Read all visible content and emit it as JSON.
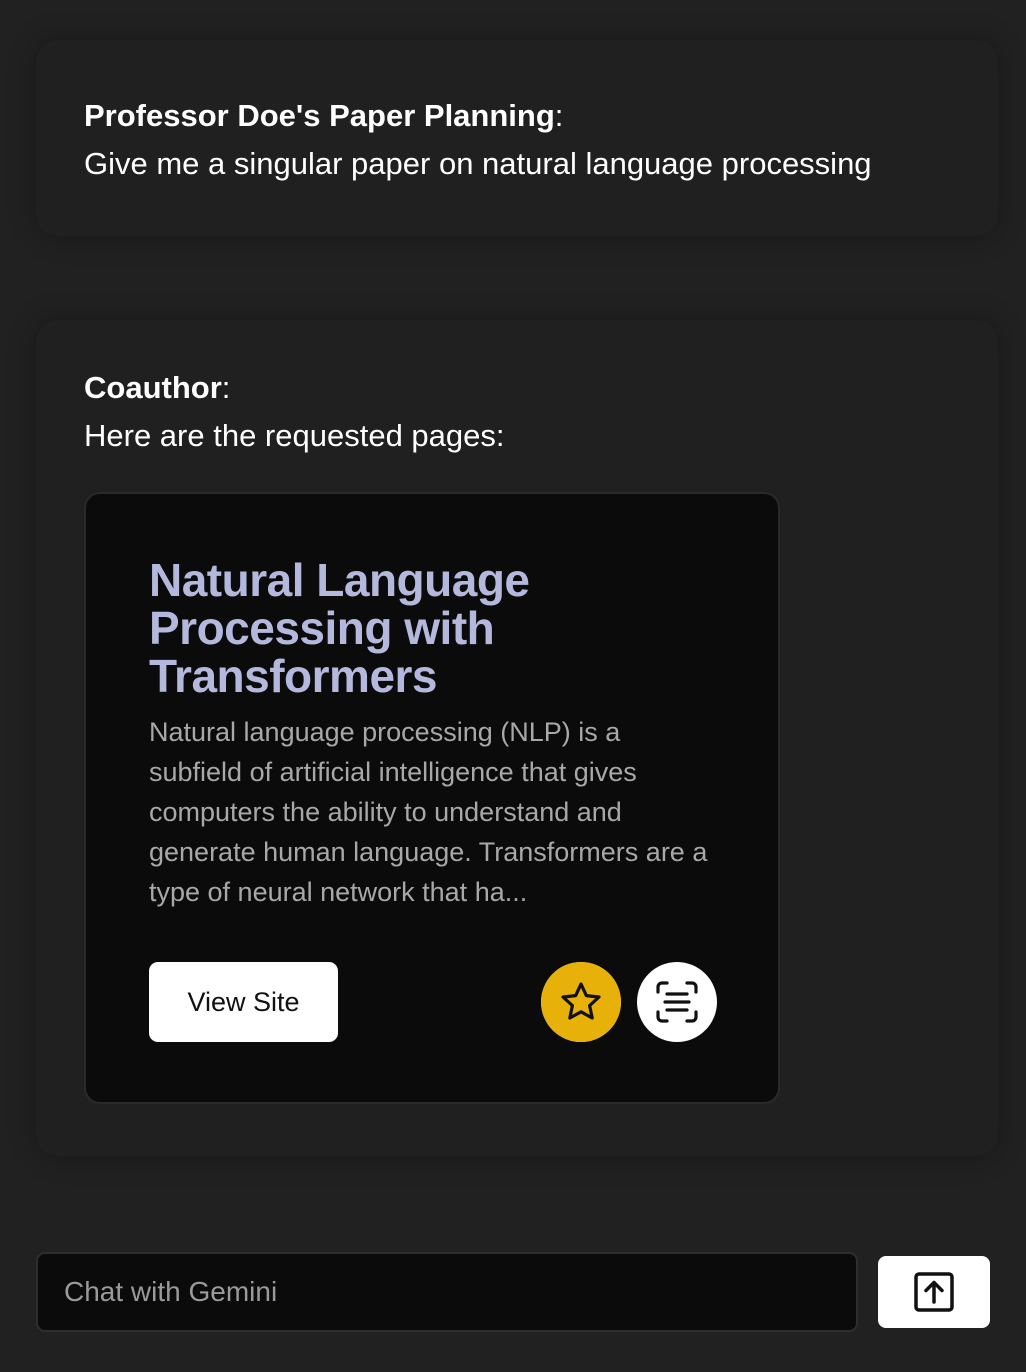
{
  "conversation": {
    "user_message": {
      "sender": "Professor Doe's Paper Planning",
      "separator": ":",
      "text": "Give me a singular paper on natural language processing"
    },
    "assistant_message": {
      "sender": "Coauthor",
      "separator": ":",
      "text": "Here are the requested pages:"
    }
  },
  "result_card": {
    "title": "Natural Language Processing with Transformers",
    "description": "Natural language processing (NLP) is a subfield of artificial intelligence that gives computers the ability to understand and generate human language. Transformers are a type of neural network that ha...",
    "view_site_label": "View Site",
    "favorite_icon": "star-icon",
    "scan_icon": "text-scan-icon"
  },
  "composer": {
    "placeholder": "Chat with Gemini",
    "value": "",
    "send_icon": "arrow-up-square-icon"
  },
  "colors": {
    "background": "#212121",
    "card_background": "#0b0b0b",
    "card_title": "#b4b8dd",
    "card_description": "#a8a8a8",
    "favorite_accent": "#e8b10a"
  }
}
